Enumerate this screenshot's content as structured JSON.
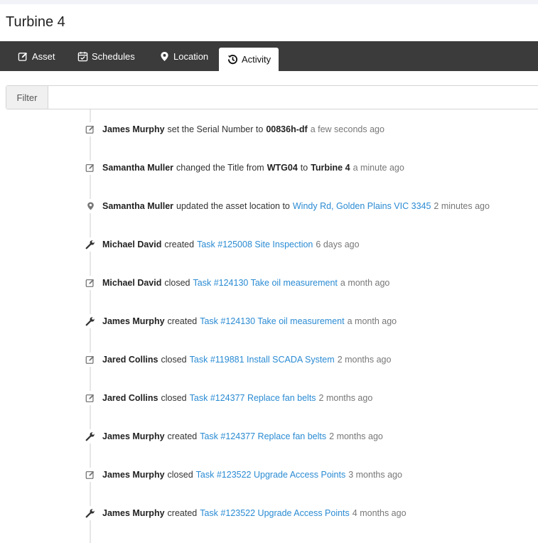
{
  "page": {
    "title": "Turbine 4"
  },
  "tabs": [
    {
      "label": "Asset",
      "icon": "edit-icon"
    },
    {
      "label": "Schedules",
      "icon": "calendar-check-icon"
    },
    {
      "label": "Location",
      "icon": "map-marker-icon"
    },
    {
      "label": "Activity",
      "icon": "history-icon",
      "active": true
    }
  ],
  "filter": {
    "label": "Filter",
    "value": ""
  },
  "colors": {
    "tabbar": "#3b3b3b",
    "link": "#2a8bd3",
    "muted": "#777777"
  },
  "activity": [
    {
      "icon": "edit-icon",
      "user": "James Murphy",
      "action": "set the Serial Number to",
      "value": "00836h-df",
      "time": "a few seconds ago"
    },
    {
      "icon": "edit-icon",
      "user": "Samantha Muller",
      "action": "changed the Title from",
      "from": "WTG04",
      "middle": "to",
      "to": "Turbine 4",
      "time": "a minute ago"
    },
    {
      "icon": "map-marker-icon",
      "user": "Samantha Muller",
      "action": "updated the asset location to",
      "link": "Windy Rd, Golden Plains VIC 3345",
      "time": "2 minutes ago"
    },
    {
      "icon": "wrench-icon",
      "user": "Michael David",
      "action": "created",
      "link": "Task #125008 Site Inspection",
      "time": "6 days ago"
    },
    {
      "icon": "edit-icon",
      "user": "Michael David",
      "action": "closed",
      "link": "Task #124130 Take oil measurement",
      "time": "a month ago"
    },
    {
      "icon": "wrench-icon",
      "user": "James Murphy",
      "action": "created",
      "link": "Task #124130 Take oil measurement",
      "time": "a month ago"
    },
    {
      "icon": "edit-icon",
      "user": "Jared Collins",
      "action": "closed",
      "link": "Task #119881 Install SCADA System",
      "time": "2 months ago"
    },
    {
      "icon": "edit-icon",
      "user": "Jared Collins",
      "action": "closed",
      "link": "Task #124377 Replace fan belts",
      "time": "2 months ago"
    },
    {
      "icon": "wrench-icon",
      "user": "James Murphy",
      "action": "created",
      "link": "Task #124377 Replace fan belts",
      "time": "2 months ago"
    },
    {
      "icon": "edit-icon",
      "user": "James Murphy",
      "action": "closed",
      "link": "Task #123522 Upgrade Access Points",
      "time": "3 months ago"
    },
    {
      "icon": "wrench-icon",
      "user": "James Murphy",
      "action": "created",
      "link": "Task #123522 Upgrade Access Points",
      "time": "4 months ago"
    }
  ]
}
